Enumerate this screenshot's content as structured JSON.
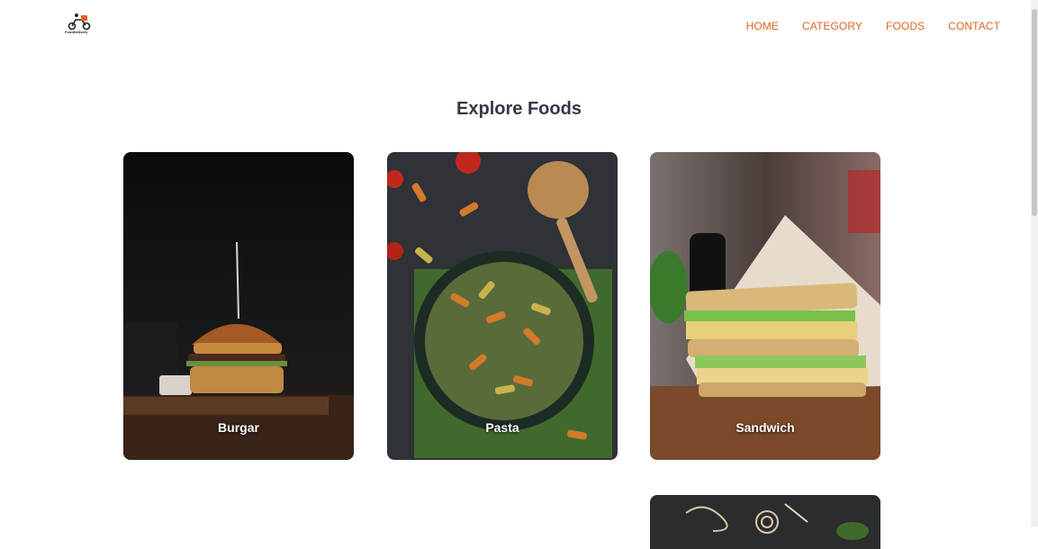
{
  "logo": {
    "text": "FoodDelivery"
  },
  "nav": {
    "items": [
      "HOME",
      "CATEGORY",
      "FOODS",
      "CONTACT"
    ]
  },
  "heading": "Explore Foods",
  "cards": [
    {
      "label": "Burgar"
    },
    {
      "label": "Pasta"
    },
    {
      "label": "Sandwich"
    }
  ],
  "colors": {
    "accent": "#e0641e",
    "heading": "#333845"
  }
}
